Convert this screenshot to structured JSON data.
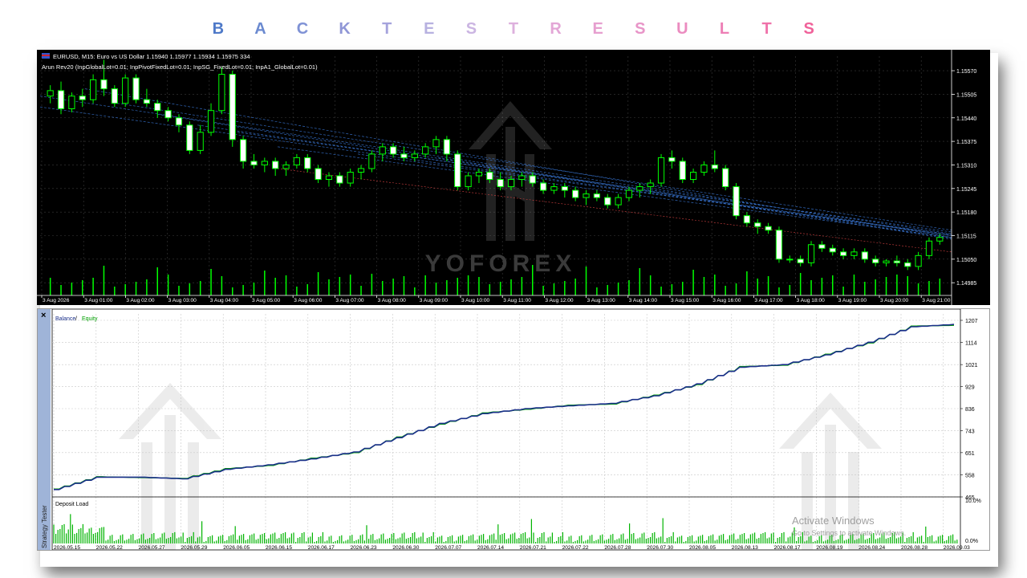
{
  "header": {
    "letters": [
      "B",
      "A",
      "C",
      "K",
      "T",
      "E",
      "S",
      "T",
      "R",
      "E",
      "S",
      "U",
      "L",
      "T",
      "S"
    ],
    "colors": [
      "#4e79c8",
      "#6b8ad0",
      "#7f92d5",
      "#8f96d6",
      "#a5a3dc",
      "#b7b1e0",
      "#cbb5e2",
      "#ddb0dd",
      "#e3a6d6",
      "#e69fcf",
      "#e895c8",
      "#eb8cc0",
      "#ed7eb5",
      "#ef72aa",
      "#f0629a"
    ]
  },
  "price_chart": {
    "symbol_line": "EURUSD, M15: Euro vs US Dollar  1.15940 1.15977 1.15934 1.15975  334",
    "ea_line": "Arun Rev20 (InpGlobalLot=0.01; InpPivotFixedLot=0.01; InpSG_FixedLot=0.01; InpA1_GlobalLot=0.01)",
    "y_labels": [
      "1.15570",
      "1.15505",
      "1.15440",
      "1.15375",
      "1.15310",
      "1.15245",
      "1.15180",
      "1.15115",
      "1.15050",
      "1.14985"
    ],
    "x_labels": [
      "3 Aug 2026",
      "3 Aug 01:00",
      "3 Aug 02:00",
      "3 Aug 03:00",
      "3 Aug 04:00",
      "3 Aug 05:00",
      "3 Aug 06:00",
      "3 Aug 07:00",
      "3 Aug 08:00",
      "3 Aug 09:00",
      "3 Aug 10:00",
      "3 Aug 11:00",
      "3 Aug 12:00",
      "3 Aug 13:00",
      "3 Aug 14:00",
      "3 Aug 15:00",
      "3 Aug 16:00",
      "3 Aug 17:00",
      "3 Aug 18:00",
      "3 Aug 19:00",
      "3 Aug 20:00",
      "3 Aug 21:00"
    ],
    "watermark": "YOFOREX",
    "colors": {
      "background": "#000000",
      "bull": "#ffffff",
      "bear": "#00ff00",
      "grid": "#3a3a3a",
      "text": "#ffffff",
      "trend_blue": "#3a78d8",
      "trend_red": "#d04040"
    },
    "candles": [
      [
        1.155,
        1.1553,
        1.1548,
        1.15515
      ],
      [
        1.15515,
        1.1554,
        1.1545,
        1.15465
      ],
      [
        1.15465,
        1.1551,
        1.15455,
        1.155
      ],
      [
        1.155,
        1.1552,
        1.1547,
        1.1549
      ],
      [
        1.1549,
        1.1556,
        1.1548,
        1.15545
      ],
      [
        1.15545,
        1.156,
        1.155,
        1.1552
      ],
      [
        1.1552,
        1.1553,
        1.1547,
        1.1548
      ],
      [
        1.1548,
        1.1556,
        1.1547,
        1.1555
      ],
      [
        1.1555,
        1.1556,
        1.1548,
        1.1549
      ],
      [
        1.1549,
        1.1552,
        1.1547,
        1.1548
      ],
      [
        1.1548,
        1.1549,
        1.1544,
        1.1546
      ],
      [
        1.1546,
        1.1547,
        1.1543,
        1.1544
      ],
      [
        1.1544,
        1.1545,
        1.154,
        1.1542
      ],
      [
        1.1542,
        1.1543,
        1.1534,
        1.1535
      ],
      [
        1.1535,
        1.1542,
        1.1534,
        1.154
      ],
      [
        1.154,
        1.1548,
        1.1539,
        1.1546
      ],
      [
        1.1546,
        1.1558,
        1.1545,
        1.1556
      ],
      [
        1.1556,
        1.1557,
        1.1536,
        1.1538
      ],
      [
        1.1538,
        1.1539,
        1.153,
        1.1532
      ],
      [
        1.1532,
        1.1534,
        1.153,
        1.1531
      ],
      [
        1.1531,
        1.1533,
        1.1529,
        1.1532
      ],
      [
        1.1532,
        1.1533,
        1.1528,
        1.153
      ],
      [
        1.153,
        1.1532,
        1.1528,
        1.1531
      ],
      [
        1.1531,
        1.1534,
        1.153,
        1.1533
      ],
      [
        1.1533,
        1.1534,
        1.1529,
        1.153
      ],
      [
        1.153,
        1.1531,
        1.1526,
        1.1527
      ],
      [
        1.1527,
        1.1529,
        1.1525,
        1.1528
      ],
      [
        1.1528,
        1.1529,
        1.1525,
        1.1526
      ],
      [
        1.1526,
        1.153,
        1.1525,
        1.1529
      ],
      [
        1.1529,
        1.1531,
        1.1527,
        1.153
      ],
      [
        1.153,
        1.1535,
        1.1529,
        1.1534
      ],
      [
        1.1534,
        1.1537,
        1.1532,
        1.1536
      ],
      [
        1.1536,
        1.1537,
        1.1533,
        1.1534
      ],
      [
        1.1534,
        1.1536,
        1.1532,
        1.1533
      ],
      [
        1.1533,
        1.1535,
        1.1532,
        1.1534
      ],
      [
        1.1534,
        1.1537,
        1.1533,
        1.1536
      ],
      [
        1.1536,
        1.1539,
        1.1534,
        1.1538
      ],
      [
        1.1538,
        1.1539,
        1.1532,
        1.1534
      ],
      [
        1.1534,
        1.1535,
        1.1524,
        1.1525
      ],
      [
        1.1525,
        1.1529,
        1.1524,
        1.1528
      ],
      [
        1.1528,
        1.153,
        1.1526,
        1.1529
      ],
      [
        1.1529,
        1.153,
        1.1526,
        1.1527
      ],
      [
        1.1527,
        1.1529,
        1.1524,
        1.1525
      ],
      [
        1.1525,
        1.1528,
        1.1524,
        1.1527
      ],
      [
        1.1527,
        1.1529,
        1.1525,
        1.1528
      ],
      [
        1.1528,
        1.1529,
        1.1525,
        1.1526
      ],
      [
        1.1526,
        1.1527,
        1.1523,
        1.1524
      ],
      [
        1.1524,
        1.1526,
        1.1523,
        1.1525
      ],
      [
        1.1525,
        1.1526,
        1.1522,
        1.1524
      ],
      [
        1.1524,
        1.1525,
        1.1521,
        1.1522
      ],
      [
        1.1522,
        1.1524,
        1.152,
        1.1523
      ],
      [
        1.1523,
        1.1524,
        1.1521,
        1.1522
      ],
      [
        1.1522,
        1.1523,
        1.1519,
        1.152
      ],
      [
        1.152,
        1.1523,
        1.1519,
        1.1522
      ],
      [
        1.1522,
        1.1525,
        1.1521,
        1.1524
      ],
      [
        1.1524,
        1.1526,
        1.1522,
        1.1525
      ],
      [
        1.1525,
        1.1527,
        1.1523,
        1.1526
      ],
      [
        1.1526,
        1.1534,
        1.1525,
        1.1533
      ],
      [
        1.1533,
        1.1535,
        1.153,
        1.1532
      ],
      [
        1.1532,
        1.1533,
        1.1526,
        1.1527
      ],
      [
        1.1527,
        1.153,
        1.1526,
        1.1529
      ],
      [
        1.1529,
        1.1532,
        1.1528,
        1.1531
      ],
      [
        1.1531,
        1.1535,
        1.1529,
        1.153
      ],
      [
        1.153,
        1.1531,
        1.1524,
        1.1525
      ],
      [
        1.1525,
        1.1526,
        1.1516,
        1.1517
      ],
      [
        1.1517,
        1.1518,
        1.1514,
        1.1515
      ],
      [
        1.1515,
        1.1516,
        1.1512,
        1.1514
      ],
      [
        1.1514,
        1.1515,
        1.1512,
        1.1513
      ],
      [
        1.1513,
        1.1514,
        1.1504,
        1.1505
      ],
      [
        1.1505,
        1.1506,
        1.1504,
        1.1505
      ],
      [
        1.1505,
        1.1506,
        1.1503,
        1.1504
      ],
      [
        1.1504,
        1.151,
        1.1503,
        1.1509
      ],
      [
        1.1509,
        1.151,
        1.1507,
        1.1508
      ],
      [
        1.1508,
        1.1509,
        1.1506,
        1.1507
      ],
      [
        1.1507,
        1.1508,
        1.1505,
        1.1506
      ],
      [
        1.1506,
        1.1508,
        1.1505,
        1.1507
      ],
      [
        1.1507,
        1.1508,
        1.1504,
        1.1505
      ],
      [
        1.1505,
        1.1506,
        1.1503,
        1.1504
      ],
      [
        1.1504,
        1.1505,
        1.1503,
        1.15045
      ],
      [
        1.15045,
        1.1506,
        1.1503,
        1.1504
      ],
      [
        1.1504,
        1.1505,
        1.1502,
        1.1503
      ],
      [
        1.1503,
        1.1507,
        1.1502,
        1.1506
      ],
      [
        1.1506,
        1.1511,
        1.1505,
        1.151
      ],
      [
        1.151,
        1.1512,
        1.1509,
        1.1511
      ]
    ]
  },
  "tester": {
    "close_glyph": "×",
    "side_tab": "Strategy Tester",
    "legend_balance": "Balance",
    "legend_sep": " / ",
    "legend_equity": "Equity",
    "y_labels": [
      "1207",
      "1114",
      "1021",
      "929",
      "836",
      "743",
      "651",
      "558",
      "465"
    ],
    "deposit_label": "Deposit Load",
    "load_labels": [
      "10.0%",
      "0.0%"
    ],
    "x_labels": [
      "2026.05.15",
      "2026.05.22",
      "2026.05.27",
      "2026.05.29",
      "2026.06.05",
      "2026.06.15",
      "2026.06.17",
      "2026.06.23",
      "2026.06.30",
      "2026.07.07",
      "2026.07.14",
      "2026.07.21",
      "2026.07.22",
      "2026.07.28",
      "2026.07.30",
      "2026.08.05",
      "2026.08.13",
      "2026.08.17",
      "2026.08.19",
      "2026.08.24",
      "2026.08.28",
      "2026.09.03"
    ],
    "activate_line1": "Activate Windows",
    "activate_line2": "Go to Settings to activate Windows.",
    "colors": {
      "balance": "#1a2f8a",
      "equity": "#00a000",
      "grid": "#c8c8c8",
      "load": "#00b400",
      "side_tab": "#9fb4d8"
    }
  },
  "chart_data": {
    "type": "line",
    "title": "",
    "ylabel": "",
    "ylim": [
      465,
      1234
    ],
    "series": [
      {
        "name": "Balance",
        "x": [
          "2026.05.15",
          "2026.05.22",
          "2026.05.27",
          "2026.05.29",
          "2026.06.05",
          "2026.06.15",
          "2026.06.17",
          "2026.06.23",
          "2026.06.30",
          "2026.07.07",
          "2026.07.14",
          "2026.07.21",
          "2026.07.22",
          "2026.07.28",
          "2026.07.30",
          "2026.08.05",
          "2026.08.13",
          "2026.08.17",
          "2026.08.19",
          "2026.08.24",
          "2026.08.28",
          "2026.09.03"
        ],
        "values": [
          496,
          548,
          548,
          541,
          581,
          600,
          625,
          654,
          714,
          774,
          815,
          836,
          848,
          858,
          890,
          940,
          1010,
          1021,
          1062,
          1115,
          1180,
          1190
        ]
      },
      {
        "name": "Equity",
        "x": [
          "2026.05.15",
          "2026.05.22",
          "2026.05.27",
          "2026.05.29",
          "2026.06.05",
          "2026.06.15",
          "2026.06.17",
          "2026.06.23",
          "2026.06.30",
          "2026.07.07",
          "2026.07.14",
          "2026.07.21",
          "2026.07.22",
          "2026.07.28",
          "2026.07.30",
          "2026.08.05",
          "2026.08.13",
          "2026.08.17",
          "2026.08.19",
          "2026.08.24",
          "2026.08.28",
          "2026.09.03"
        ],
        "values": [
          498,
          550,
          546,
          543,
          584,
          597,
          628,
          651,
          717,
          771,
          818,
          833,
          851,
          855,
          893,
          937,
          1013,
          1018,
          1065,
          1112,
          1183,
          1186
        ]
      }
    ]
  }
}
